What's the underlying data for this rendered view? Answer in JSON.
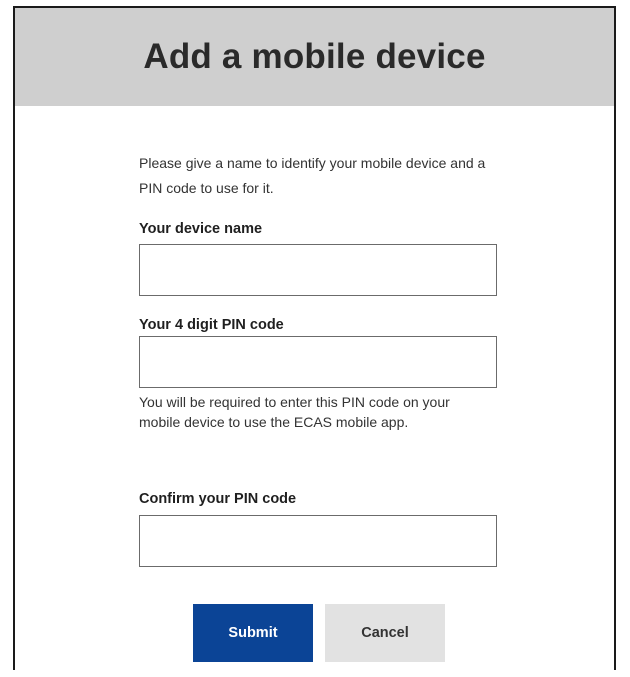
{
  "dialog": {
    "title": "Add a mobile device",
    "intro": "Please give a name to identify your mobile device and a PIN code to use for it."
  },
  "form": {
    "device_name": {
      "label": "Your device name",
      "value": "",
      "placeholder": ""
    },
    "pin": {
      "label": "Your 4 digit PIN code",
      "value": "",
      "placeholder": "",
      "help": "You will be required to enter this PIN code on your mobile device to use the ECAS mobile app."
    },
    "confirm_pin": {
      "label": "Confirm your PIN code",
      "value": "",
      "placeholder": ""
    }
  },
  "actions": {
    "submit_label": "Submit",
    "cancel_label": "Cancel"
  },
  "colors": {
    "header_bg": "#cfcfcf",
    "submit_bg": "#0b4496",
    "cancel_bg": "#e2e2e2"
  }
}
